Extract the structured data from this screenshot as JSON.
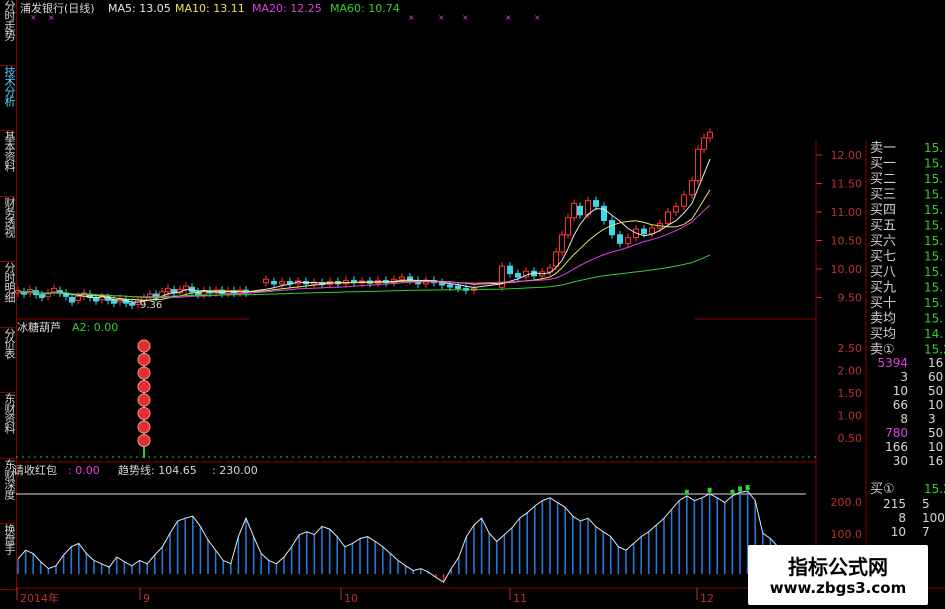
{
  "sidebar": {
    "tabs": [
      {
        "label": "分时走势",
        "active": false
      },
      {
        "label": "技术分析",
        "active": true
      },
      {
        "label": "基本资料",
        "active": false
      },
      {
        "label": "财务透视",
        "active": false
      },
      {
        "label": "分时明细",
        "active": false
      },
      {
        "label": "分价表",
        "active": false
      },
      {
        "label": "东财资料",
        "active": false
      },
      {
        "label": "东财深度",
        "active": false
      },
      {
        "label": "换盘手",
        "active": false
      }
    ]
  },
  "main": {
    "title": "浦发银行(日线)",
    "ma": [
      {
        "label": "MA5: 13.05",
        "color": "#e8e8e8"
      },
      {
        "label": "MA10: 13.11",
        "color": "#f0e060"
      },
      {
        "label": "MA20: 12.25",
        "color": "#e040e0"
      },
      {
        "label": "MA60: 10.74",
        "color": "#30d030"
      }
    ],
    "low_marker": "9.36"
  },
  "indicator1": {
    "name": "冰糖葫芦",
    "a2": "A2: 0.00",
    "yticks": [
      "2.50",
      "2.00",
      "1.50",
      "1.00",
      "0.50"
    ]
  },
  "indicator2": {
    "name": "请收红包",
    "val": ": 0.00",
    "trend": "趋势线: 104.65",
    "extra": ": 230.00",
    "yticks": [
      "200.0",
      "100.0"
    ]
  },
  "xaxis": {
    "labels": [
      "2014年",
      "9",
      "10",
      "11",
      "12"
    ]
  },
  "orderbook": {
    "rows": [
      {
        "label": "卖一",
        "value": "15."
      },
      {
        "label": "买一",
        "value": "15."
      },
      {
        "label": "买二",
        "value": "15."
      },
      {
        "label": "买三",
        "value": "15."
      },
      {
        "label": "买四",
        "value": "15."
      },
      {
        "label": "买五",
        "value": "15."
      },
      {
        "label": "买六",
        "value": "15."
      },
      {
        "label": "买七",
        "value": "15."
      },
      {
        "label": "买八",
        "value": "15."
      },
      {
        "label": "买九",
        "value": "15."
      },
      {
        "label": "买十",
        "value": "15."
      },
      {
        "label": "卖均",
        "value": "15."
      },
      {
        "label": "买均",
        "value": "14."
      },
      {
        "label": "卖①",
        "value": "15.2"
      }
    ],
    "queue": [
      {
        "a": "5394",
        "b": "16",
        "hl": true
      },
      {
        "a": "3",
        "b": "60",
        "hl": false
      },
      {
        "a": "10",
        "b": "50",
        "hl": false
      },
      {
        "a": "66",
        "b": "10",
        "hl": false
      },
      {
        "a": "8",
        "b": "3",
        "hl": false
      },
      {
        "a": "780",
        "b": "50",
        "hl": true
      },
      {
        "a": "166",
        "b": "10",
        "hl": false
      },
      {
        "a": "30",
        "b": "16",
        "hl": false
      }
    ],
    "buy1": {
      "label": "买①",
      "value": "15.2"
    },
    "queue2": [
      {
        "a": "215",
        "b": "5"
      },
      {
        "a": "8",
        "b": "100"
      },
      {
        "a": "10",
        "b": "7"
      }
    ]
  },
  "watermark": {
    "title": "指标公式网",
    "url": "www.zbgs3.com"
  },
  "chart_data": [
    {
      "type": "candlestick",
      "title": "浦发银行(日线)",
      "ylabel": "",
      "yticks": [
        12.0,
        11.5,
        11.0,
        10.5,
        10.0,
        9.5
      ],
      "ylim": [
        9.0,
        12.6
      ],
      "candles": [
        {
          "x": 18,
          "o": 9.58,
          "c": 9.62
        },
        {
          "x": 24,
          "o": 9.6,
          "c": 9.56
        },
        {
          "x": 30,
          "o": 9.58,
          "c": 9.64
        },
        {
          "x": 36,
          "o": 9.62,
          "c": 9.55
        },
        {
          "x": 42,
          "o": 9.55,
          "c": 9.5
        },
        {
          "x": 48,
          "o": 9.52,
          "c": 9.58
        },
        {
          "x": 54,
          "o": 9.6,
          "c": 9.66
        },
        {
          "x": 60,
          "o": 9.62,
          "c": 9.58
        },
        {
          "x": 66,
          "o": 9.58,
          "c": 9.52
        },
        {
          "x": 72,
          "o": 9.5,
          "c": 9.42
        },
        {
          "x": 78,
          "o": 9.45,
          "c": 9.52
        },
        {
          "x": 84,
          "o": 9.52,
          "c": 9.58
        },
        {
          "x": 90,
          "o": 9.56,
          "c": 9.5
        },
        {
          "x": 96,
          "o": 9.5,
          "c": 9.44
        },
        {
          "x": 102,
          "o": 9.46,
          "c": 9.52
        },
        {
          "x": 108,
          "o": 9.5,
          "c": 9.45
        },
        {
          "x": 114,
          "o": 9.46,
          "c": 9.4
        },
        {
          "x": 120,
          "o": 9.42,
          "c": 9.48
        },
        {
          "x": 126,
          "o": 9.46,
          "c": 9.4
        },
        {
          "x": 132,
          "o": 9.4,
          "c": 9.37
        },
        {
          "x": 138,
          "o": 9.38,
          "c": 9.45
        },
        {
          "x": 144,
          "o": 9.44,
          "c": 9.5
        },
        {
          "x": 150,
          "o": 9.5,
          "c": 9.56
        },
        {
          "x": 156,
          "o": 9.56,
          "c": 9.5
        },
        {
          "x": 162,
          "o": 9.52,
          "c": 9.6
        },
        {
          "x": 168,
          "o": 9.6,
          "c": 9.66
        },
        {
          "x": 174,
          "o": 9.64,
          "c": 9.58
        },
        {
          "x": 180,
          "o": 9.58,
          "c": 9.64
        },
        {
          "x": 186,
          "o": 9.64,
          "c": 9.7
        },
        {
          "x": 192,
          "o": 9.68,
          "c": 9.6
        },
        {
          "x": 198,
          "o": 9.6,
          "c": 9.55
        },
        {
          "x": 204,
          "o": 9.55,
          "c": 9.62
        },
        {
          "x": 210,
          "o": 9.62,
          "c": 9.58
        },
        {
          "x": 216,
          "o": 9.58,
          "c": 9.63
        },
        {
          "x": 222,
          "o": 9.63,
          "c": 9.57
        },
        {
          "x": 228,
          "o": 9.57,
          "c": 9.62
        },
        {
          "x": 234,
          "o": 9.62,
          "c": 9.58
        },
        {
          "x": 240,
          "o": 9.58,
          "c": 9.63
        },
        {
          "x": 246,
          "o": 9.63,
          "c": 9.58
        },
        {
          "x": 266,
          "o": 9.76,
          "c": 9.82
        },
        {
          "x": 274,
          "o": 9.78,
          "c": 9.74
        },
        {
          "x": 282,
          "o": 9.74,
          "c": 9.78
        },
        {
          "x": 290,
          "o": 9.78,
          "c": 9.74
        },
        {
          "x": 298,
          "o": 9.74,
          "c": 9.79
        },
        {
          "x": 306,
          "o": 9.78,
          "c": 9.74
        },
        {
          "x": 314,
          "o": 9.74,
          "c": 9.77
        },
        {
          "x": 322,
          "o": 9.76,
          "c": 9.73
        },
        {
          "x": 330,
          "o": 9.73,
          "c": 9.78
        },
        {
          "x": 338,
          "o": 9.78,
          "c": 9.74
        },
        {
          "x": 346,
          "o": 9.74,
          "c": 9.8
        },
        {
          "x": 354,
          "o": 9.8,
          "c": 9.76
        },
        {
          "x": 362,
          "o": 9.76,
          "c": 9.79
        },
        {
          "x": 370,
          "o": 9.79,
          "c": 9.75
        },
        {
          "x": 378,
          "o": 9.75,
          "c": 9.8
        },
        {
          "x": 386,
          "o": 9.8,
          "c": 9.76
        },
        {
          "x": 394,
          "o": 9.76,
          "c": 9.82
        },
        {
          "x": 402,
          "o": 9.82,
          "c": 9.86
        },
        {
          "x": 410,
          "o": 9.86,
          "c": 9.8
        },
        {
          "x": 418,
          "o": 9.8,
          "c": 9.74
        },
        {
          "x": 426,
          "o": 9.74,
          "c": 9.8
        },
        {
          "x": 434,
          "o": 9.8,
          "c": 9.76
        },
        {
          "x": 442,
          "o": 9.76,
          "c": 9.72
        },
        {
          "x": 450,
          "o": 9.72,
          "c": 9.7
        },
        {
          "x": 458,
          "o": 9.7,
          "c": 9.66
        },
        {
          "x": 466,
          "o": 9.66,
          "c": 9.64
        },
        {
          "x": 474,
          "o": 9.64,
          "c": 9.66
        },
        {
          "x": 502,
          "o": 9.68,
          "c": 10.05
        },
        {
          "x": 510,
          "o": 10.05,
          "c": 9.92
        },
        {
          "x": 518,
          "o": 9.92,
          "c": 9.86
        },
        {
          "x": 526,
          "o": 9.86,
          "c": 9.96
        },
        {
          "x": 534,
          "o": 9.96,
          "c": 9.88
        },
        {
          "x": 542,
          "o": 9.88,
          "c": 9.95
        },
        {
          "x": 550,
          "o": 9.95,
          "c": 10.02
        },
        {
          "x": 556,
          "o": 10.05,
          "c": 10.3
        },
        {
          "x": 562,
          "o": 10.3,
          "c": 10.6
        },
        {
          "x": 568,
          "o": 10.6,
          "c": 10.9
        },
        {
          "x": 574,
          "o": 10.9,
          "c": 11.15
        },
        {
          "x": 580,
          "o": 11.1,
          "c": 10.95
        },
        {
          "x": 588,
          "o": 10.95,
          "c": 11.2
        },
        {
          "x": 596,
          "o": 11.2,
          "c": 11.1
        },
        {
          "x": 604,
          "o": 11.1,
          "c": 10.85
        },
        {
          "x": 612,
          "o": 10.85,
          "c": 10.6
        },
        {
          "x": 620,
          "o": 10.6,
          "c": 10.45
        },
        {
          "x": 628,
          "o": 10.45,
          "c": 10.55
        },
        {
          "x": 636,
          "o": 10.55,
          "c": 10.7
        },
        {
          "x": 644,
          "o": 10.7,
          "c": 10.62
        },
        {
          "x": 652,
          "o": 10.62,
          "c": 10.72
        },
        {
          "x": 660,
          "o": 10.72,
          "c": 10.8
        },
        {
          "x": 668,
          "o": 10.8,
          "c": 11.0
        },
        {
          "x": 676,
          "o": 11.0,
          "c": 11.1
        },
        {
          "x": 684,
          "o": 11.1,
          "c": 11.3
        },
        {
          "x": 692,
          "o": 11.3,
          "c": 11.55
        },
        {
          "x": 698,
          "o": 11.55,
          "c": 12.1
        },
        {
          "x": 704,
          "o": 12.1,
          "c": 12.3
        },
        {
          "x": 710,
          "o": 12.3,
          "c": 12.4
        }
      ]
    },
    {
      "type": "bar",
      "title": "请收红包",
      "yticks": [
        200.0,
        100.0
      ],
      "values": [
        22,
        35,
        30,
        18,
        8,
        12,
        28,
        40,
        45,
        30,
        20,
        15,
        10,
        25,
        18,
        12,
        20,
        15,
        28,
        40,
        60,
        78,
        82,
        85,
        70,
        50,
        35,
        20,
        15,
        55,
        82,
        55,
        30,
        20,
        15,
        25,
        40,
        58,
        62,
        58,
        70,
        66,
        55,
        40,
        45,
        52,
        55,
        48,
        40,
        30,
        20,
        12,
        5,
        8,
        3,
        -5,
        -12,
        8,
        25,
        55,
        72,
        82,
        60,
        48,
        58,
        68,
        82,
        90,
        100,
        108,
        112,
        105,
        98,
        85,
        78,
        82,
        70,
        62,
        55,
        40,
        35,
        45,
        55,
        62,
        72,
        82,
        95,
        108,
        115,
        108,
        112,
        118,
        112,
        105,
        115,
        120,
        122,
        108,
        60,
        52,
        40,
        30,
        20,
        35
      ]
    }
  ]
}
